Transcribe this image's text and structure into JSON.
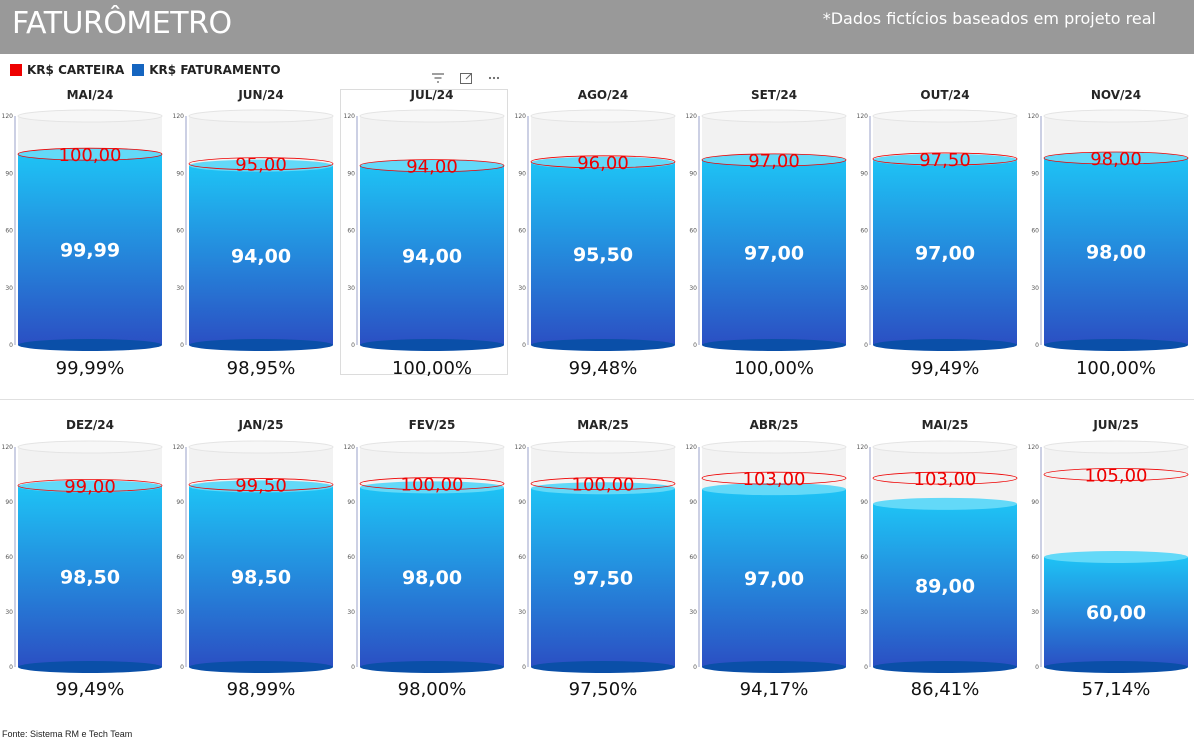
{
  "header": {
    "title": "FATURÔMETRO",
    "subtitle": "*Dados fictícios baseados em projeto real"
  },
  "legend": {
    "items": [
      {
        "label": "KR$ CARTEIRA",
        "color": "#ee0000"
      },
      {
        "label": "KR$ FATURAMENTO",
        "color": "#1565c0"
      }
    ]
  },
  "toolbar": {
    "icons": [
      "filter-icon",
      "focus-mode-icon",
      "more-options-icon"
    ]
  },
  "colors": {
    "fill_top": "#1ec3f5",
    "fill_bottom": "#2b4fc3",
    "fill_cap": "#63d9f8",
    "bottom_ellipse": "#0a4fa8",
    "empty": "#f2f2f2",
    "carteira": "#ee0000"
  },
  "chart_data": {
    "type": "cylinder-gauge",
    "axis_ticks": [
      0,
      30,
      60,
      90,
      120
    ],
    "ylim": [
      0,
      120
    ],
    "series": [
      {
        "name": "KR$ CARTEIRA",
        "key": "carteira"
      },
      {
        "name": "KR$ FATURAMENTO",
        "key": "faturamento"
      }
    ],
    "panels": [
      {
        "month": "MAI/24",
        "carteira": "100,00",
        "faturamento": "99,99",
        "carteira_value": 100.0,
        "faturamento_value": 99.99,
        "percent": "99,99%"
      },
      {
        "month": "JUN/24",
        "carteira": "95,00",
        "faturamento": "94,00",
        "carteira_value": 95.0,
        "faturamento_value": 94.0,
        "percent": "98,95%"
      },
      {
        "month": "JUL/24",
        "carteira": "94,00",
        "faturamento": "94,00",
        "carteira_value": 94.0,
        "faturamento_value": 94.0,
        "percent": "100,00%"
      },
      {
        "month": "AGO/24",
        "carteira": "96,00",
        "faturamento": "95,50",
        "carteira_value": 96.0,
        "faturamento_value": 95.5,
        "percent": "99,48%"
      },
      {
        "month": "SET/24",
        "carteira": "97,00",
        "faturamento": "97,00",
        "carteira_value": 97.0,
        "faturamento_value": 97.0,
        "percent": "100,00%"
      },
      {
        "month": "OUT/24",
        "carteira": "97,50",
        "faturamento": "97,00",
        "carteira_value": 97.5,
        "faturamento_value": 97.0,
        "percent": "99,49%"
      },
      {
        "month": "NOV/24",
        "carteira": "98,00",
        "faturamento": "98,00",
        "carteira_value": 98.0,
        "faturamento_value": 98.0,
        "percent": "100,00%"
      },
      {
        "month": "DEZ/24",
        "carteira": "99,00",
        "faturamento": "98,50",
        "carteira_value": 99.0,
        "faturamento_value": 98.5,
        "percent": "99,49%"
      },
      {
        "month": "JAN/25",
        "carteira": "99,50",
        "faturamento": "98,50",
        "carteira_value": 99.5,
        "faturamento_value": 98.5,
        "percent": "98,99%"
      },
      {
        "month": "FEV/25",
        "carteira": "100,00",
        "faturamento": "98,00",
        "carteira_value": 100.0,
        "faturamento_value": 98.0,
        "percent": "98,00%"
      },
      {
        "month": "MAR/25",
        "carteira": "100,00",
        "faturamento": "97,50",
        "carteira_value": 100.0,
        "faturamento_value": 97.5,
        "percent": "97,50%"
      },
      {
        "month": "ABR/25",
        "carteira": "103,00",
        "faturamento": "97,00",
        "carteira_value": 103.0,
        "faturamento_value": 97.0,
        "percent": "94,17%"
      },
      {
        "month": "MAI/25",
        "carteira": "103,00",
        "faturamento": "89,00",
        "carteira_value": 103.0,
        "faturamento_value": 89.0,
        "percent": "86,41%"
      },
      {
        "month": "JUN/25",
        "carteira": "105,00",
        "faturamento": "60,00",
        "carteira_value": 105.0,
        "faturamento_value": 60.0,
        "percent": "57,14%"
      }
    ]
  },
  "footer": {
    "source": "Fonte: Sistema RM e Tech Team"
  }
}
